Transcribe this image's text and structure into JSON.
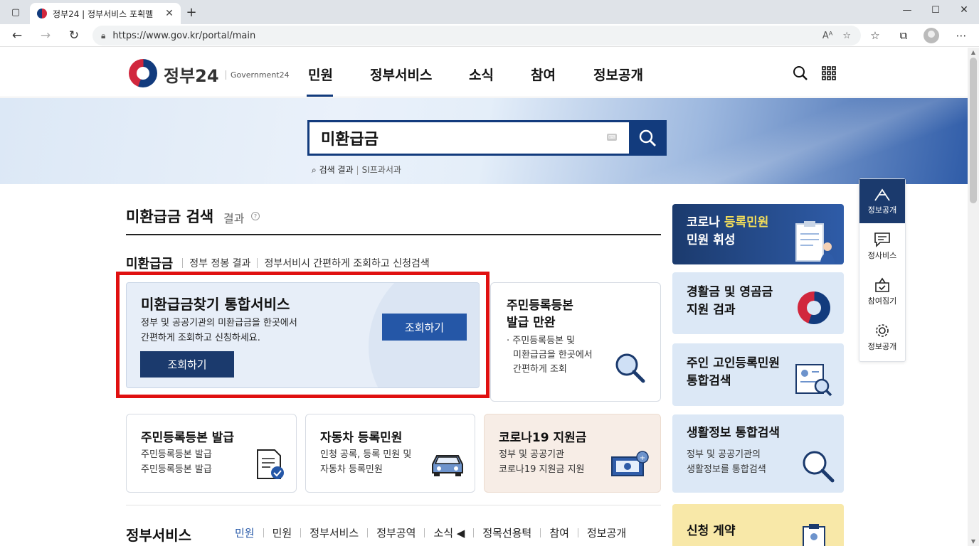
{
  "browser": {
    "tab_title": "정부24 | 정부서비스 포획펠",
    "url": "https://www.gov.kr/portal/main"
  },
  "site": {
    "logo_text": "정부24",
    "logo_sub": "Government24",
    "nav": [
      "민원",
      "정부서비스",
      "소식",
      "참여",
      "정보공개"
    ]
  },
  "search": {
    "query": "미환급금",
    "sub_label": "검색 결과",
    "sub_label2": "SI프과서과"
  },
  "results": {
    "title": "미환급금 검색",
    "title_sub": "결과",
    "filter_main": "미환급금",
    "filter_items": [
      "정부 정봉 결과",
      "정부서비시 간편하게 조회하고 신청검색"
    ]
  },
  "featured": {
    "title": "미환급금찾기 통합서비스",
    "desc_line1": "정부 및 공공기관의 미환급금을 한곳에서",
    "desc_line2": "간편하게 조회하고 신칭하세요.",
    "button_primary": "조회하기",
    "button_secondary": "조회하기"
  },
  "cards": {
    "resident": {
      "title_line1": "주민등록등본",
      "title_line2": "발급 만완",
      "desc_line1": "· 주민등록등본 및",
      "desc_line2": "미환급금을 한곳에서",
      "desc_line3": "간편하게 조회"
    },
    "c1": {
      "title": "주민등록등본 발급",
      "desc_line1": "주민등록등본 발급",
      "desc_line2": "주민등록등본 발급"
    },
    "c2": {
      "title": "자동차 등록민원",
      "desc_line1": "인청 공록, 등록 민원 및",
      "desc_line2": "자동차 등록민원"
    },
    "c3": {
      "title": "코로나19 지원금",
      "desc_line1": "정부 및 공공기관",
      "desc_line2": "코로나19 지원금 지원"
    }
  },
  "banners": {
    "b1": {
      "line1_a": "코로나 ",
      "line1_b": "등록민원",
      "line2": "민원 휘성"
    },
    "b2": {
      "line1": "경활금 및 영곰금",
      "line2": "지원 검과"
    },
    "b3": {
      "line1": "주인 고인등록민원",
      "line2": "통합검색"
    },
    "b4": {
      "line1": "생활정보 통합검색",
      "desc_line1": "정부 및 공공기관의",
      "desc_line2": "생활정보를 통합검색"
    },
    "b5": {
      "line1": "신청 게약"
    }
  },
  "quick_menu": [
    "정보공개",
    "정사비스",
    "참여짐기",
    "정보공개"
  ],
  "services": {
    "title": "정부서비스",
    "tabs": [
      "민원",
      "민원",
      "정부서비스",
      "정부공역",
      "소식 ◀",
      "정목선용텩",
      "참여",
      "정보공개"
    ]
  },
  "colors": {
    "brand_navy": "#123b7d",
    "accent_blue": "#2557a7",
    "highlight_red": "#e01010",
    "banner_yellow": "#f2dd5a"
  }
}
